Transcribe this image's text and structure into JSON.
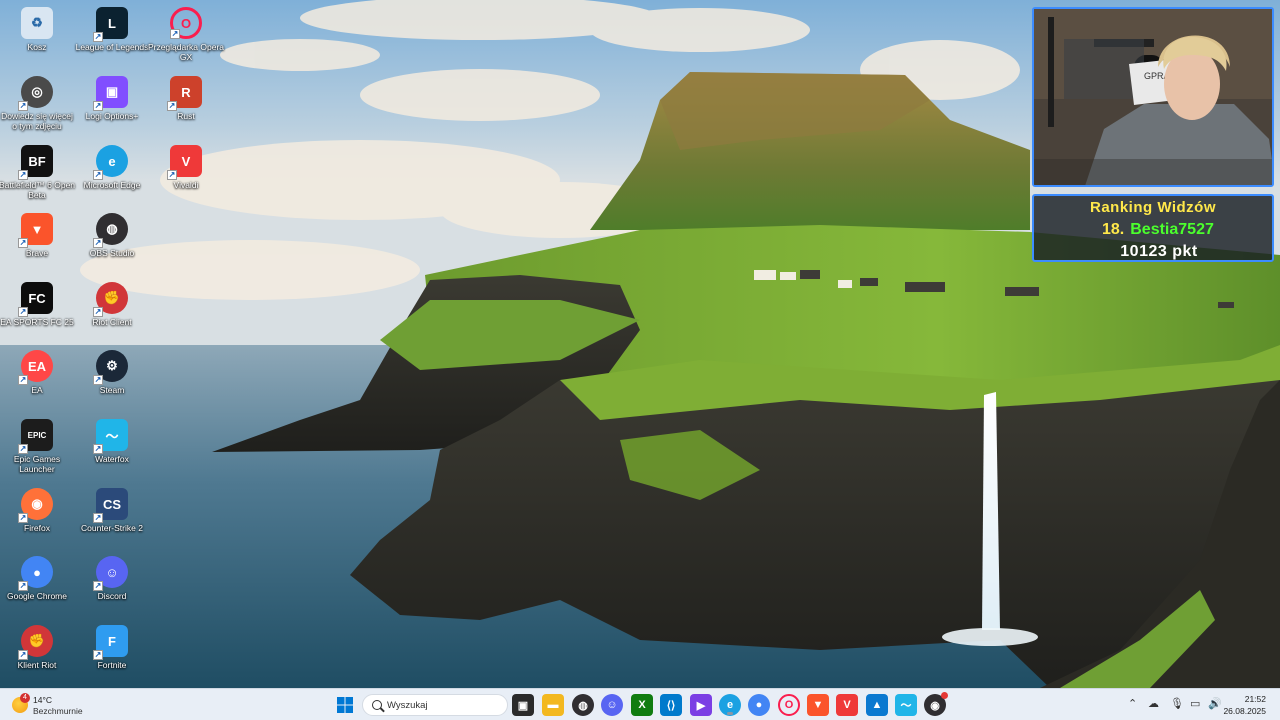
{
  "desktop_icons": [
    {
      "label": "Kosz",
      "icon": "recycle-bin-icon",
      "color": "#d9e6f2"
    },
    {
      "label": "Dowiedz się więcej o tym zdjęciu",
      "icon": "camera-info-icon",
      "color": "#4a4a4a"
    },
    {
      "label": "Battlefield™ 6 Open Beta",
      "icon": "battlefield-icon",
      "color": "#111111"
    },
    {
      "label": "Brave",
      "icon": "brave-icon",
      "color": "#fb542b"
    },
    {
      "label": "EA SPORTS FC 25",
      "icon": "ea-fc-icon",
      "color": "#0c0c0c"
    },
    {
      "label": "EA",
      "icon": "ea-icon",
      "color": "#ff4747"
    },
    {
      "label": "Epic Games Launcher",
      "icon": "epic-games-icon",
      "color": "#1c1c1c"
    },
    {
      "label": "Firefox",
      "icon": "firefox-icon",
      "color": "#ff7139"
    },
    {
      "label": "Google Chrome",
      "icon": "chrome-icon",
      "color": "#4285f4"
    },
    {
      "label": "Klient Riot",
      "icon": "riot-client-icon",
      "color": "#d13639"
    },
    {
      "label": "League of Legends",
      "icon": "league-of-legends-icon",
      "color": "#0b2230"
    },
    {
      "label": "Logi Options+",
      "icon": "logi-options-icon",
      "color": "#814eff"
    },
    {
      "label": "Microsoft Edge",
      "icon": "edge-icon",
      "color": "#1ba1e2"
    },
    {
      "label": "OBS Studio",
      "icon": "obs-icon",
      "color": "#302e31"
    },
    {
      "label": "Riot Client",
      "icon": "riot-client-icon",
      "color": "#d13639"
    },
    {
      "label": "Steam",
      "icon": "steam-icon",
      "color": "#1b2838"
    },
    {
      "label": "Waterfox",
      "icon": "waterfox-icon",
      "color": "#20b5e8"
    },
    {
      "label": "Counter-Strike 2",
      "icon": "counter-strike-icon",
      "color": "#2b4a7a"
    },
    {
      "label": "Discord",
      "icon": "discord-icon",
      "color": "#5865f2"
    },
    {
      "label": "Fortnite",
      "icon": "fortnite-icon",
      "color": "#2f9cf0"
    },
    {
      "label": "Przeglądarka Opera GX",
      "icon": "opera-gx-icon",
      "color": "#fa1e4e"
    },
    {
      "label": "Rust",
      "icon": "rust-icon",
      "color": "#cd412b"
    },
    {
      "label": "Vivaldi",
      "icon": "vivaldi-icon",
      "color": "#ef3939"
    }
  ],
  "ranking": {
    "title": "Ranking Widzów",
    "rank": "18.",
    "username": "Bestia7527",
    "points": "10123 pkt"
  },
  "taskbar": {
    "weather_temp": "14°C",
    "weather_condition": "Bezchmurnie",
    "weather_badge": "4",
    "search_placeholder": "Wyszukaj",
    "apps": [
      {
        "icon": "start-icon",
        "color": "#0078d4"
      },
      {
        "icon": "task-view-icon",
        "color": "#2b2b2b"
      },
      {
        "icon": "file-explorer-icon",
        "color": "#f3b81f"
      },
      {
        "icon": "obs-icon",
        "color": "#302e31"
      },
      {
        "icon": "discord-icon",
        "color": "#5865f2"
      },
      {
        "icon": "xbox-icon",
        "color": "#107c10"
      },
      {
        "icon": "vscode-icon",
        "color": "#007acc"
      },
      {
        "icon": "media-icon",
        "color": "#7b3fe4"
      },
      {
        "icon": "edge-icon",
        "color": "#1ba1e2"
      },
      {
        "icon": "chrome-icon",
        "color": "#4285f4"
      },
      {
        "icon": "opera-gx-icon",
        "color": "#fa1e4e"
      },
      {
        "icon": "brave-icon",
        "color": "#fb542b"
      },
      {
        "icon": "vivaldi-icon",
        "color": "#ef3939"
      },
      {
        "icon": "photos-icon",
        "color": "#0b79d0"
      },
      {
        "icon": "waterfox-icon",
        "color": "#20b5e8"
      },
      {
        "icon": "obs-recording-icon",
        "color": "#302e31"
      }
    ],
    "time": "21:52",
    "date": "26.08.2025"
  }
}
